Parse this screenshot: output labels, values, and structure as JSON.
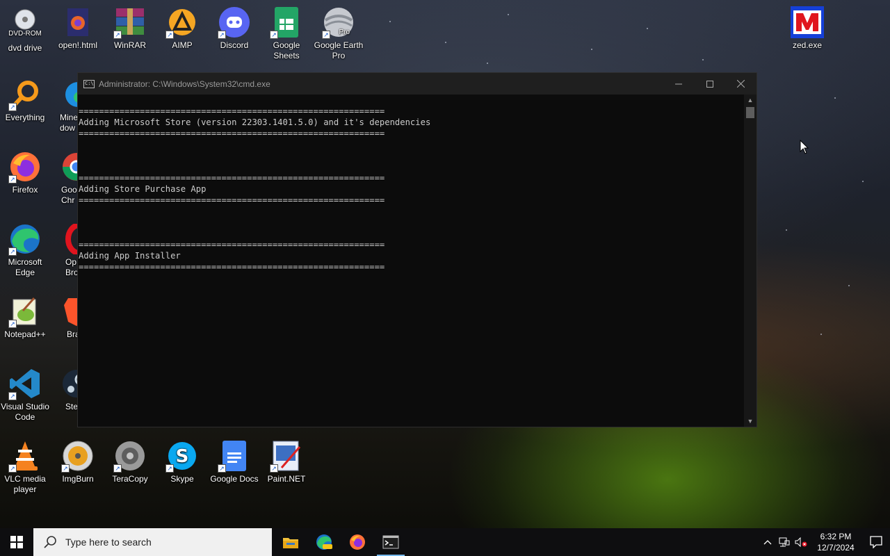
{
  "desktop": {
    "icons": [
      {
        "label": "dvd drive",
        "sublabel": "DVD-ROM"
      },
      {
        "label": "open!.html"
      },
      {
        "label": "WinRAR"
      },
      {
        "label": "AIMP"
      },
      {
        "label": "Discord"
      },
      {
        "label": "Google Sheets"
      },
      {
        "label": "Google Earth Pro",
        "badge": "Pro"
      },
      {
        "label": "zed.exe"
      },
      {
        "label": "Everything"
      },
      {
        "label": "Mine dow"
      },
      {
        "label": "Firefox"
      },
      {
        "label": "Goo Chr"
      },
      {
        "label": "Microsoft Edge"
      },
      {
        "label": "Op Brow"
      },
      {
        "label": "Notepad++"
      },
      {
        "label": "Bra"
      },
      {
        "label": "Visual Studio Code"
      },
      {
        "label": "Ste"
      },
      {
        "label": "VLC media player"
      },
      {
        "label": "ImgBurn"
      },
      {
        "label": "TeraCopy"
      },
      {
        "label": "Skype"
      },
      {
        "label": "Google Docs"
      },
      {
        "label": "Paint.NET"
      }
    ]
  },
  "cmd": {
    "title": "Administrator: C:\\Windows\\System32\\cmd.exe",
    "lines": [
      "============================================================",
      "Adding Microsoft Store (version 22303.1401.5.0) and it's dependencies",
      "============================================================",
      "",
      "",
      "",
      "============================================================",
      "Adding Store Purchase App",
      "============================================================",
      "",
      "",
      "",
      "============================================================",
      "Adding App Installer",
      "============================================================"
    ]
  },
  "taskbar": {
    "search_placeholder": "Type here to search",
    "time": "6:32 PM",
    "date": "12/7/2024"
  },
  "colors": {
    "console_bg": "#0c0c0c",
    "console_text": "#cccccc",
    "taskbar_bg": "#0e0e10",
    "accent": "#76b9ed"
  }
}
